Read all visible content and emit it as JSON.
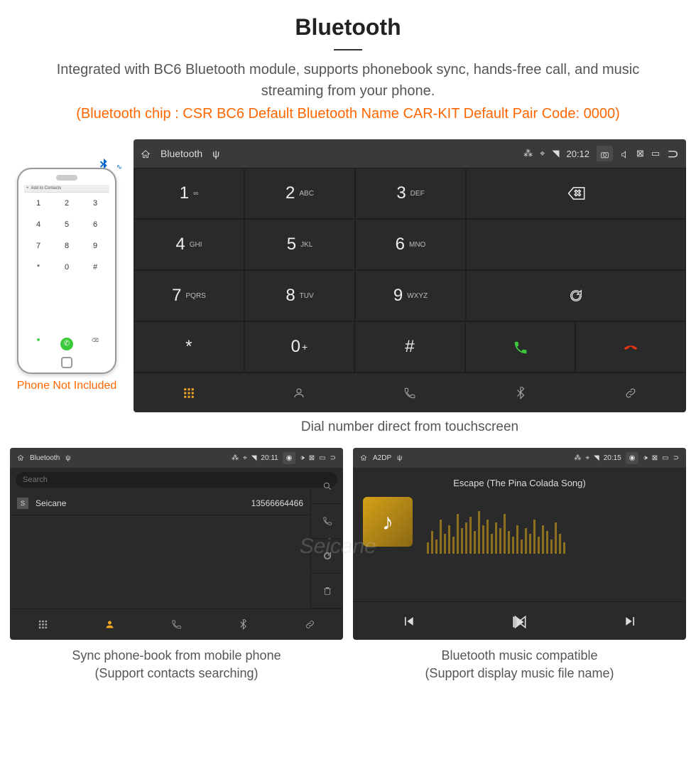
{
  "header": {
    "title": "Bluetooth",
    "description": "Integrated with BC6 Bluetooth module, supports phonebook sync, hands-free call, and music streaming from your phone.",
    "specs": "(Bluetooth chip : CSR BC6    Default Bluetooth Name CAR-KIT    Default Pair Code: 0000)"
  },
  "phone": {
    "add_contact": "Add to Contacts",
    "note": "Phone Not Included",
    "keys": [
      "1",
      "2",
      "3",
      "4",
      "5",
      "6",
      "7",
      "8",
      "9",
      "*",
      "0",
      "#"
    ]
  },
  "dialer": {
    "status": {
      "title": "Bluetooth",
      "time": "20:12"
    },
    "keys": [
      {
        "n": "1",
        "s": "∞"
      },
      {
        "n": "2",
        "s": "ABC"
      },
      {
        "n": "3",
        "s": "DEF"
      },
      {
        "n": "4",
        "s": "GHI"
      },
      {
        "n": "5",
        "s": "JKL"
      },
      {
        "n": "6",
        "s": "MNO"
      },
      {
        "n": "7",
        "s": "PQRS"
      },
      {
        "n": "8",
        "s": "TUV"
      },
      {
        "n": "9",
        "s": "WXYZ"
      },
      {
        "n": "*",
        "s": ""
      },
      {
        "n": "0",
        "s": "+"
      },
      {
        "n": "#",
        "s": ""
      }
    ],
    "caption": "Dial number direct from touchscreen"
  },
  "phonebook": {
    "status": {
      "title": "Bluetooth",
      "time": "20:11"
    },
    "search_placeholder": "Search",
    "contact": {
      "badge": "S",
      "name": "Seicane",
      "number": "13566664466"
    },
    "caption_line1": "Sync phone-book from mobile phone",
    "caption_line2": "(Support contacts searching)"
  },
  "music": {
    "status": {
      "title": "A2DP",
      "time": "20:15"
    },
    "song": "Escape (The Pina Colada Song)",
    "caption_line1": "Bluetooth music compatible",
    "caption_line2": "(Support display music file name)"
  },
  "watermark": "Seicane"
}
